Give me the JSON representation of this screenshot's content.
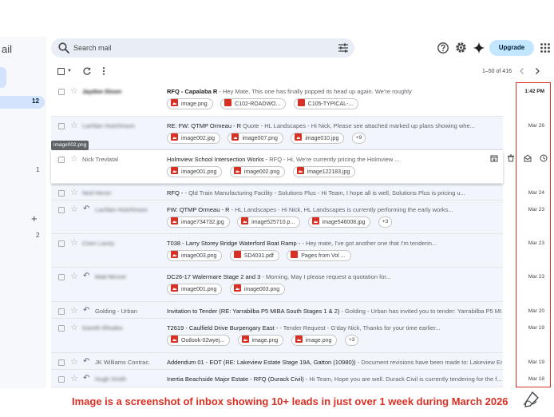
{
  "app": {
    "name_fragment": "ail"
  },
  "search": {
    "placeholder": "Search mail"
  },
  "header": {
    "upgrade_label": "Upgrade"
  },
  "rail": {
    "inbox_count": "12",
    "label_count_1": "1",
    "plus": "+",
    "label_count_2": "2"
  },
  "toolbar": {
    "pagination": "1–50 of 416"
  },
  "tooltip": "image002.png",
  "icons": {
    "search": "search-icon",
    "tune": "tune-icon",
    "help": "help-icon",
    "settings": "gear-icon",
    "gemini": "sparkle-icon",
    "apps": "apps-grid-icon",
    "refresh": "refresh-icon",
    "more": "more-vert-icon",
    "archive": "archive-icon",
    "delete": "trash-icon",
    "mark_read": "envelope-open-icon",
    "snooze": "clock-icon"
  },
  "colors": {
    "accent": "#c2e7ff",
    "highlight": "#d93025",
    "selected_rail": "#d3e3fd"
  },
  "emails": [
    {
      "sender": "Jaydon Dixon",
      "subject": "RFQ - Capalaba R",
      "snippet": " - Hey Mate, This one has finally popped its head up again. We're roughly",
      "date": "1:42 PM",
      "attachments": [
        {
          "type": "img",
          "name": "image.png"
        },
        {
          "type": "pdf",
          "name": "C102-ROADWO..."
        },
        {
          "type": "pdf",
          "name": "C105-TYPICAL-..."
        }
      ],
      "more": ""
    },
    {
      "sender": "Lachlan Hutchinson",
      "subject": "RE: FW: QTMP Ormeau - R",
      "snippet": " Quote - HL Landscapes - Hi Nick, Please see attached marked up plans showing whe...",
      "date": "Mar 26",
      "attachments": [
        {
          "type": "img",
          "name": "image002.jpg"
        },
        {
          "type": "img",
          "name": "image007.png"
        },
        {
          "type": "img",
          "name": "image010.jpg"
        }
      ],
      "more": "+9"
    },
    {
      "sender": "Nick Trevlatal",
      "subject": "Holmview School Intersection Works - ",
      "snippet": " RFQ - Hi, We're currently pricing the Holmview ...",
      "date": "",
      "attachments": [
        {
          "type": "img",
          "name": "image001.png"
        },
        {
          "type": "img",
          "name": "image002.png"
        },
        {
          "type": "img",
          "name": "image122183.jpg"
        }
      ],
      "more": ""
    },
    {
      "sender": "Ned Heron",
      "subject": "RFQ - ",
      "snippet": " - Qld Train Manufacturing Facility - Solutions Plus - Hi Team, I hope all is well, Solutions Plus is pricing u...",
      "date": "Mar 24",
      "attachments": [],
      "more": ""
    },
    {
      "sender": "Lachlan Hutchinson",
      "subject": "FW: QTMP Ormeau - R",
      "snippet": " - HL Landscapes - Hi Nick, HL Landscapes is currently performing the early works...",
      "date": "Mar 23",
      "attachments": [
        {
          "type": "img",
          "name": "image734732.jpg"
        },
        {
          "type": "img",
          "name": "image525710.p..."
        },
        {
          "type": "img",
          "name": "image546008.jpg"
        }
      ],
      "more": "+3"
    },
    {
      "sender": "Coen Lacey",
      "subject": "T038 - Larry Storey Bridge Waterford Boat Ramp - ",
      "snippet": " - Hey mate, I've got another one that I'm tenderin...",
      "date": "Mar 23",
      "attachments": [
        {
          "type": "img",
          "name": "image003.png"
        },
        {
          "type": "pdf",
          "name": "SD4031.pdf"
        },
        {
          "type": "pdf",
          "name": "Pages from Vol ..."
        }
      ],
      "more": ""
    },
    {
      "sender": "Matt McIvor",
      "subject": "DC26-17 Walermare Stage 2 and 3 ",
      "snippet": " - Morning, May I please request a quotation for...",
      "date": "Mar 23",
      "attachments": [
        {
          "type": "img",
          "name": "image001.png"
        },
        {
          "type": "img",
          "name": "image003.png"
        }
      ],
      "more": ""
    },
    {
      "sender": "Golding - Urban",
      "subject": "Invitation to Tender (RE: Yarrabilba P5 MIBA South Stages 1 & 2)",
      "snippet": " - Golding - Urban has invited you to tender: Yarrabilba P5 MI...",
      "date": "Mar 20",
      "attachments": [],
      "more": ""
    },
    {
      "sender": "Gareth Rhodes",
      "subject": "T2619 - Caulfield Drive Burpengary East - ",
      "snippet": " - Tender Request - G'day Nick, Thanks for your time earlier...",
      "date": "Mar 19",
      "attachments": [
        {
          "type": "img",
          "name": "Outlook-02wyej..."
        },
        {
          "type": "img",
          "name": "image.png"
        },
        {
          "type": "img",
          "name": "image.png"
        }
      ],
      "more": "+3"
    },
    {
      "sender": "JK Williams Contrac.",
      "subject": "Addendum 01 - EOT (RE: Lakeview Estate Stage 19A, Gatton (10980))",
      "snippet": " - Document revisions have been made to: Lakeview Esta...",
      "date": "Mar 19",
      "attachments": [],
      "more": ""
    },
    {
      "sender": "Hugh Smith",
      "subject": "Inertia Beachside Major Estate - RFQ (Durack Civil)",
      "snippet": " - Hi Team, Hope you are well. Durack Civil is currently tendering for the f...",
      "date": "Mar 18",
      "attachments": [],
      "more": ""
    }
  ],
  "caption": "Image is a screenshot of inbox showing 10+ leads in just over 1 week during March 2026"
}
